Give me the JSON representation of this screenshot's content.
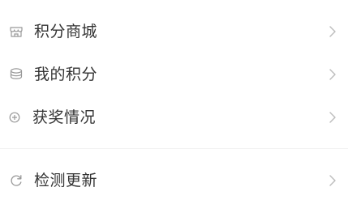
{
  "menu": {
    "items": [
      {
        "label": "积分商城",
        "icon": "store-icon"
      },
      {
        "label": "我的积分",
        "icon": "coin-stack-icon"
      },
      {
        "label": "获奖情况",
        "icon": "plus-circle-icon"
      },
      {
        "label": "检测更新",
        "icon": "refresh-icon"
      }
    ]
  },
  "colors": {
    "text": "#333333",
    "icon": "#999999",
    "chevron": "#bbbbbb",
    "divider": "#f2f2f2",
    "background": "#ffffff"
  }
}
